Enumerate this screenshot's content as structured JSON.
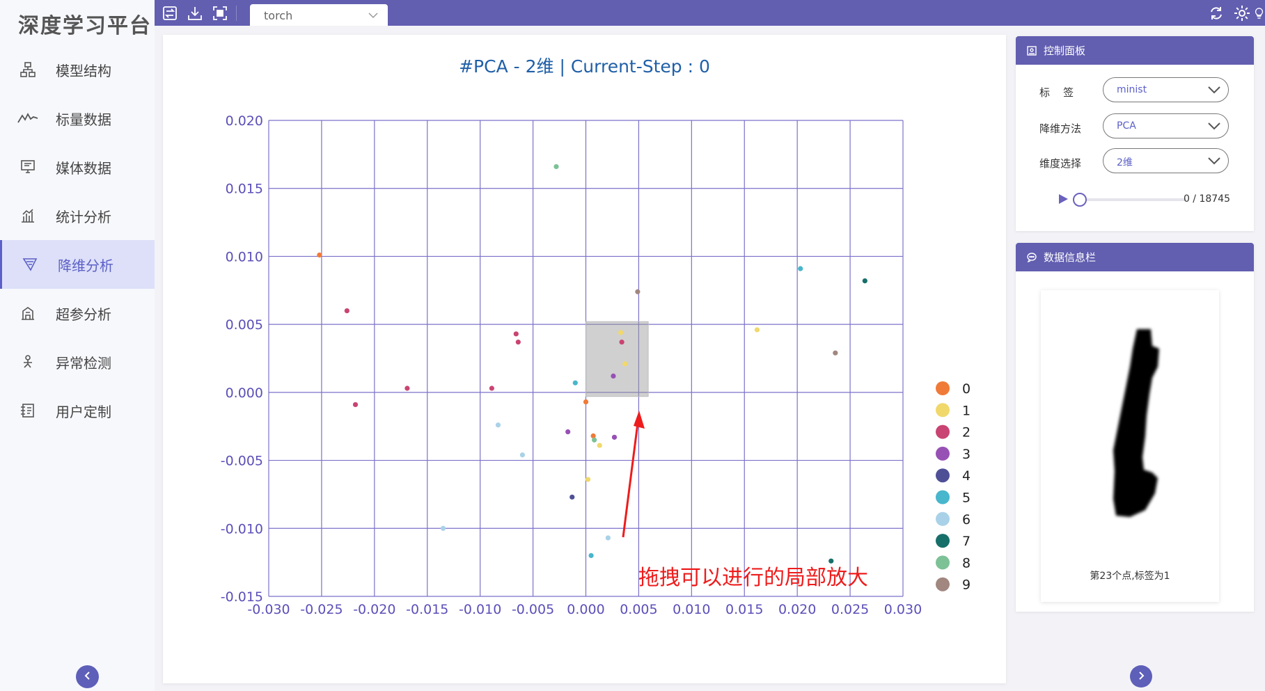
{
  "app": {
    "title": "深度学习平台"
  },
  "sidebar": {
    "items": [
      {
        "label": "模型结构",
        "icon": "model-structure-icon",
        "active": false
      },
      {
        "label": "标量数据",
        "icon": "scalar-line-icon",
        "active": false
      },
      {
        "label": "媒体数据",
        "icon": "media-monitor-icon",
        "active": false
      },
      {
        "label": "统计分析",
        "icon": "statistics-chart-icon",
        "active": false
      },
      {
        "label": "降维分析",
        "icon": "dimension-filter-icon",
        "active": true
      },
      {
        "label": "超参分析",
        "icon": "hyperparam-icon",
        "active": false
      },
      {
        "label": "异常检测",
        "icon": "anomaly-icon",
        "active": false
      },
      {
        "label": "用户定制",
        "icon": "custom-icon",
        "active": false
      }
    ]
  },
  "toolbar": {
    "model_select": {
      "value": "torch"
    }
  },
  "chart": {
    "title": "#PCA - 2维 | Current-Step : 0"
  },
  "annotation": "拖拽可以进行的局部放大",
  "control_panel": {
    "title": "控制面板",
    "label_field": {
      "label": "标    签",
      "value": "minist"
    },
    "method_field": {
      "label": "降维方法",
      "value": "PCA"
    },
    "dim_field": {
      "label": "维度选择",
      "value": "2维"
    },
    "slider": {
      "text": "0 / 18745",
      "current": 0,
      "max": 18745
    }
  },
  "info_panel": {
    "title": "数据信息栏",
    "caption": "第23个点,标签为1"
  },
  "colors": {
    "accent": "#625eb0",
    "grid": "#7b71c9",
    "axis_text": "#5b4fb8",
    "title": "#1f5fa7",
    "annotation": "#ee1c1c"
  },
  "chart_data": {
    "type": "scatter",
    "title": "#PCA - 2维 | Current-Step : 0",
    "xlim": [
      -0.03,
      0.03
    ],
    "ylim": [
      -0.015,
      0.02
    ],
    "x_ticks": [
      "-0.030",
      "-0.025",
      "-0.020",
      "-0.015",
      "-0.010",
      "-0.005",
      "0.000",
      "0.005",
      "0.010",
      "0.015",
      "0.020",
      "0.025",
      "0.030"
    ],
    "y_ticks": [
      "0.020",
      "0.015",
      "0.010",
      "0.005",
      "0.000",
      "-0.005",
      "-0.010",
      "-0.015"
    ],
    "grid": true,
    "legend_position": "right",
    "series": [
      {
        "name": "0",
        "color": "#f07a38",
        "points": [
          [
            -0.0252,
            0.0101
          ],
          [
            0.0,
            -0.0007
          ],
          [
            0.0007,
            -0.0032
          ]
        ]
      },
      {
        "name": "1",
        "color": "#f0d86b",
        "points": [
          [
            0.0033,
            0.0044
          ],
          [
            0.0037,
            0.0021
          ],
          [
            0.0013,
            -0.0039
          ],
          [
            0.0002,
            -0.0064
          ],
          [
            0.0162,
            0.0046
          ]
        ]
      },
      {
        "name": "2",
        "color": "#c94472",
        "points": [
          [
            -0.0226,
            0.006
          ],
          [
            -0.0218,
            -0.0009
          ],
          [
            -0.0169,
            0.0003
          ],
          [
            -0.0089,
            0.0003
          ],
          [
            -0.0066,
            0.0043
          ],
          [
            -0.0064,
            0.0037
          ],
          [
            0.0034,
            0.0037
          ]
        ]
      },
      {
        "name": "3",
        "color": "#9751b5",
        "points": [
          [
            -0.0017,
            -0.0029
          ],
          [
            0.0027,
            -0.0033
          ],
          [
            0.0026,
            0.0012
          ]
        ]
      },
      {
        "name": "4",
        "color": "#4e5096",
        "points": [
          [
            -0.0013,
            -0.0077
          ]
        ]
      },
      {
        "name": "5",
        "color": "#48b6cc",
        "points": [
          [
            -0.001,
            0.0007
          ],
          [
            0.0005,
            -0.012
          ],
          [
            0.0203,
            0.0091
          ]
        ]
      },
      {
        "name": "6",
        "color": "#a9d2e8",
        "points": [
          [
            -0.0083,
            -0.0024
          ],
          [
            -0.006,
            -0.0046
          ],
          [
            -0.0135,
            -0.01
          ],
          [
            0.0021,
            -0.0107
          ]
        ]
      },
      {
        "name": "7",
        "color": "#176f6a",
        "points": [
          [
            0.0264,
            0.0082
          ],
          [
            0.0232,
            -0.0124
          ]
        ]
      },
      {
        "name": "8",
        "color": "#7dc196",
        "points": [
          [
            -0.0028,
            0.0166
          ],
          [
            0.0008,
            -0.0035
          ]
        ]
      },
      {
        "name": "9",
        "color": "#a1877f",
        "points": [
          [
            0.0049,
            0.0074
          ],
          [
            0.0236,
            0.0029
          ]
        ]
      }
    ]
  }
}
